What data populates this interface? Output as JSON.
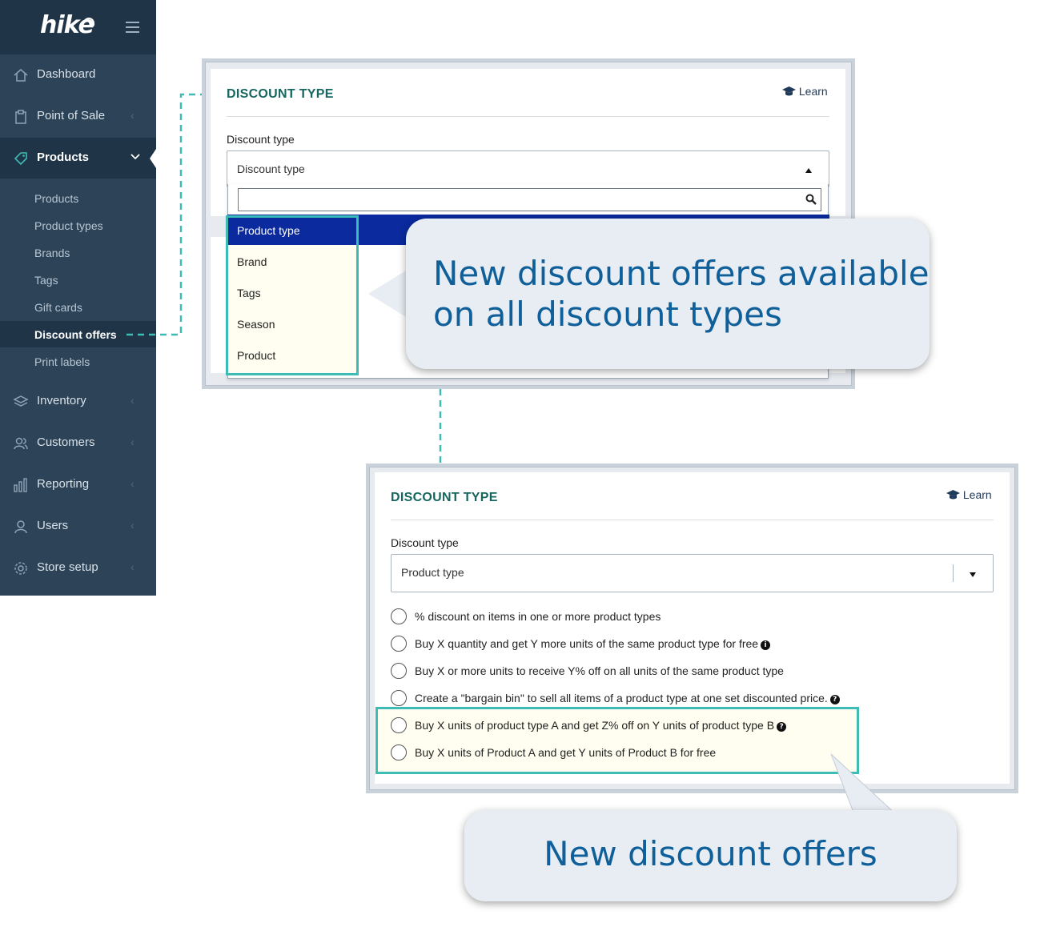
{
  "sidebar": {
    "logo": "hike",
    "items": [
      {
        "label": "Dashboard",
        "icon": "home-icon"
      },
      {
        "label": "Point of Sale",
        "icon": "clipboard-icon"
      },
      {
        "label": "Products",
        "icon": "tag-icon"
      },
      {
        "label": "Inventory",
        "icon": "layers-icon"
      },
      {
        "label": "Customers",
        "icon": "customers-icon"
      },
      {
        "label": "Reporting",
        "icon": "bar-chart-icon"
      },
      {
        "label": "Users",
        "icon": "user-icon"
      },
      {
        "label": "Store setup",
        "icon": "gear-icon"
      }
    ],
    "sub_items": [
      "Products",
      "Product types",
      "Brands",
      "Tags",
      "Gift cards",
      "Discount offers",
      "Print labels"
    ],
    "active_item": "Products",
    "active_sub_item": "Discount offers"
  },
  "top_panel": {
    "title": "DISCOUNT TYPE",
    "learn": "Learn",
    "field_label": "Discount type",
    "select_value": "Discount type",
    "options": [
      "Product type",
      "Brand",
      "Tags",
      "Season",
      "Product"
    ],
    "selected_option": "Product type"
  },
  "bottom_panel": {
    "title": "DISCOUNT TYPE",
    "learn": "Learn",
    "field_label": "Discount type",
    "select_value": "Product type",
    "radio_options": [
      "% discount on items in one or more product types",
      "Buy X quantity and get Y more units of the same product type for free",
      "Buy X or more units to receive Y% off on all units of the same product type",
      "Create a \"bargain bin\" to sell all items of a product type at one set discounted price.",
      "Buy X units of product type A and get Z% off on Y units of product type B",
      "Buy X units of Product A and get Y units of Product B for free"
    ]
  },
  "callouts": {
    "top_line1": "New discount offers available",
    "top_line2": "on all discount types",
    "bottom": "New discount offers"
  },
  "colors": {
    "sidebar_bg": "#2c4358",
    "sidebar_header": "#1f3447",
    "accent_teal": "#3cbcb4",
    "title_teal": "#166660",
    "selected_option": "#0a2a9e",
    "callout_text": "#0f5f9a"
  }
}
